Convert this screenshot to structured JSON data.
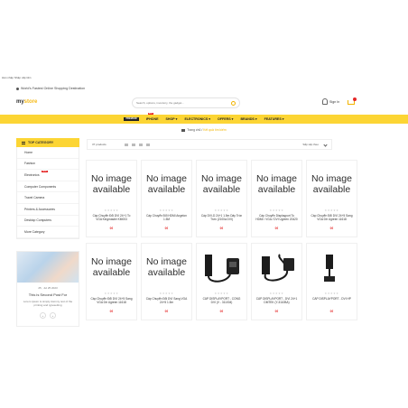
{
  "page": {
    "top_note": "Hàn nhập Nhập xấp tiền",
    "tagline": "World's Fastest Online Shopping Destination"
  },
  "header": {
    "logo_main": "my",
    "logo_accent": "store",
    "search_placeholder": "Search, options, inventory, the gadget...",
    "signin_label": "Sign In"
  },
  "nav": {
    "items": [
      {
        "label": "iPHONE",
        "hot": "HOT"
      },
      {
        "label": "SHOP"
      },
      {
        "label": "ELECTRONICS"
      },
      {
        "label": "OFFERS"
      },
      {
        "label": "BRANDS"
      },
      {
        "label": "FEATURES"
      }
    ],
    "brand_chip": "PREMIUM"
  },
  "breadcrumb": {
    "home": "Trang chủ",
    "current": "Kết quả tìm kiếm"
  },
  "sidebar": {
    "heading": "TOP CATEGORY",
    "items": [
      {
        "label": "Home"
      },
      {
        "label": "Fashion"
      },
      {
        "label": "Electronics",
        "badge": "NEW"
      },
      {
        "label": "Computer Components"
      },
      {
        "label": "Travel Camera"
      },
      {
        "label": "Printers & Accessories"
      },
      {
        "label": "Desktop Computers"
      },
      {
        "label": "More Category"
      }
    ]
  },
  "blog": {
    "date": "25 , Jul 25 2023",
    "title": "This is Second Post For",
    "text": "Lorem ipsum is simply dummy text of the printing and typesetting",
    "prev": "‹",
    "next": "›"
  },
  "toolbar": {
    "count": "37 products",
    "sort_label": "Sắp xếp theo"
  },
  "products": [
    {
      "image": "No image available",
      "stars": "★★★★★",
      "name": "Cáp Chuyển Đổi DVI 24+1 To VGA Kingmaster KM003",
      "price": "0₫"
    },
    {
      "image": "No image available",
      "stars": "★★★★★",
      "name": "Cáp Chuyển Đổi HDMI Angelon 1.5M",
      "price": "0₫"
    },
    {
      "image": "No image available",
      "stars": "★★★★★",
      "name": "Cáp DVI-D 24+1 1.5m Dây Tròn Trơn (2100a DVI)",
      "price": "0₫"
    },
    {
      "image": "No image available",
      "stars": "★★★★★",
      "name": "Cáp Chuyển Displayport To HDMI / VGA / DVI Ugreen 20420",
      "price": "0₫"
    },
    {
      "image": "No image available",
      "stars": "★★★★★",
      "name": "Cáp Chuyển Đổi DVI 24+5 Sang VGA Dtr Ugreen 11618",
      "price": "0₫"
    },
    {
      "image": "No image available",
      "stars": "★★★★★",
      "name": "Cáp Chuyển Đổi DVI 24+5 Sang VGA Dtr Ugreen 11618",
      "price": "0₫"
    },
    {
      "image": "No image available",
      "stars": "★★★★★",
      "name": "Cáp Chuyển Đổi DVI Sang VGA 24+5 1.5m",
      "price": "0₫"
    },
    {
      "image": "",
      "stars": "★★★★★",
      "name": "CÁP DISPLAYPORT - CỔNG DVI (V - 311004)",
      "price": "0₫"
    },
    {
      "image": "",
      "stars": "★★★★★",
      "name": "CÁP DISPLAYPORT - DVI 24+1 DMTEK (Y-3110BA)",
      "price": "0₫"
    },
    {
      "image": "",
      "stars": "★★★★★",
      "name": "CÁP DISPLAYPORT - DVI HP",
      "price": "0₫"
    }
  ]
}
